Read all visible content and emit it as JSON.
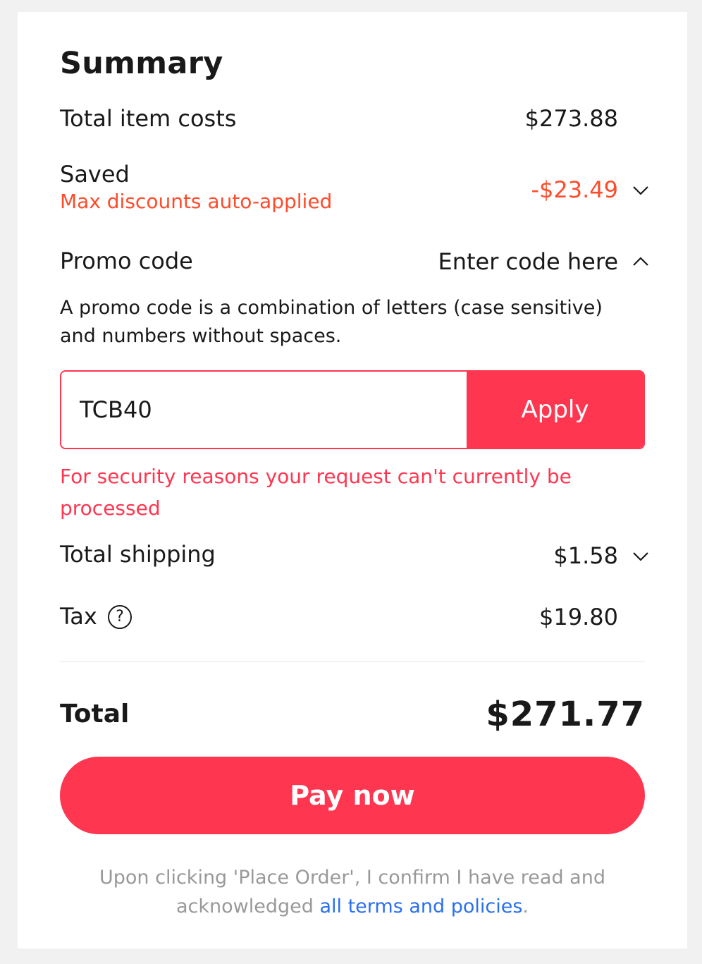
{
  "summary": {
    "title": "Summary",
    "total_item_costs": {
      "label": "Total item costs",
      "value": "$273.88"
    },
    "saved": {
      "label": "Saved",
      "note": "Max discounts auto-applied",
      "value": "-$23.49"
    },
    "promo": {
      "label": "Promo code",
      "toggle_label": "Enter code here",
      "help_text": "A promo code is a combination of letters (case sensitive) and numbers without spaces.",
      "input_value": "TCB40",
      "apply_label": "Apply",
      "error_text": "For security reasons your request can't currently be processed"
    },
    "shipping": {
      "label": "Total shipping",
      "value": "$1.58"
    },
    "tax": {
      "label": "Tax",
      "help_glyph": "?",
      "value": "$19.80"
    },
    "total": {
      "label": "Total",
      "value": "$271.77"
    },
    "pay_button": "Pay now",
    "legal": {
      "text": "Upon clicking 'Place Order', I confirm I have read and acknowledged ",
      "link": "all terms and policies",
      "end": "."
    }
  },
  "colors": {
    "accent": "#ff3650",
    "saved": "#fd4c2b",
    "link": "#2a6ff0",
    "muted": "#999999"
  },
  "icons": {
    "saved_toggle": "chevron-down-icon",
    "promo_toggle": "chevron-up-icon",
    "shipping_toggle": "chevron-down-icon",
    "tax_help": "question-circle-icon"
  }
}
